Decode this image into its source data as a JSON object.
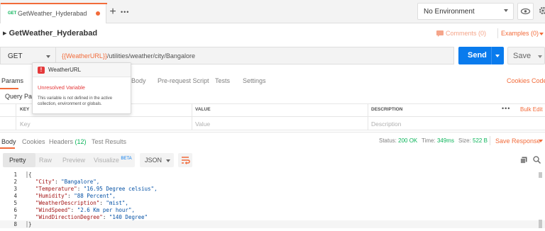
{
  "tabs": {
    "method_badge": "GET",
    "active_tab": "GetWeather_Hyderabad",
    "new_tab": "+",
    "more": "•••"
  },
  "environment": {
    "selected": "No Environment"
  },
  "request": {
    "title": "GetWeather_Hyderabad",
    "comments": "Comments (0)",
    "examples": "Examples (0)",
    "method": "GET",
    "url_variable": "{{WeatherURL}}",
    "url_path": "/utilities/weather/city/Bangalore",
    "send": "Send",
    "save": "Save"
  },
  "request_tabs": [
    "Params",
    "Body",
    "Pre-request Script",
    "Tests",
    "Settings"
  ],
  "request_links": {
    "cookies": "Cookies",
    "code": "Code"
  },
  "query_params": {
    "label": "Query Par",
    "headers": {
      "key": "KEY",
      "value": "VALUE",
      "description": "DESCRIPTION"
    },
    "placeholders": {
      "key": "Key",
      "value": "Value",
      "description": "Description"
    },
    "more": "•••",
    "bulk_edit": "Bulk Edit"
  },
  "tooltip": {
    "badge": "!",
    "variable": "WeatherURL",
    "status": "Unresolved Variable",
    "message": "This variable is not defined in the active collection, environment or globals."
  },
  "response": {
    "tabs": {
      "body": "Body",
      "cookies": "Cookies",
      "headers_label": "Headers",
      "headers_count": "(12)",
      "tests": "Test Results"
    },
    "status_label": "Status:",
    "status_value": "200 OK",
    "time_label": "Time:",
    "time_value": "349ms",
    "size_label": "Size:",
    "size_value": "522 B",
    "save_response": "Save Response",
    "formats": {
      "pretty": "Pretty",
      "raw": "Raw",
      "preview": "Preview",
      "visualize": "Visualize",
      "beta": "BETA"
    },
    "format_select": "JSON",
    "lines": [
      {
        "n": "1",
        "text": "{"
      },
      {
        "n": "2",
        "key": "\"City\"",
        "val": "\"Bangalore\","
      },
      {
        "n": "3",
        "key": "\"Temperature\"",
        "val": "\"16.95 Degree celsius\","
      },
      {
        "n": "4",
        "key": "\"Humidity\"",
        "val": "\"88 Percent\","
      },
      {
        "n": "5",
        "key": "\"WeatherDescription\"",
        "val": "\"mist\","
      },
      {
        "n": "6",
        "key": "\"WindSpeed\"",
        "val": "\"2.6 Km per hour\","
      },
      {
        "n": "7",
        "key": "\"WindDirectionDegree\"",
        "val": "\"140 Degree\""
      },
      {
        "n": "8",
        "text": "}"
      }
    ]
  },
  "colors": {
    "accent": "#f26b3a",
    "send": "#097bed",
    "ok": "#0cb45a",
    "error": "#e5393a"
  }
}
